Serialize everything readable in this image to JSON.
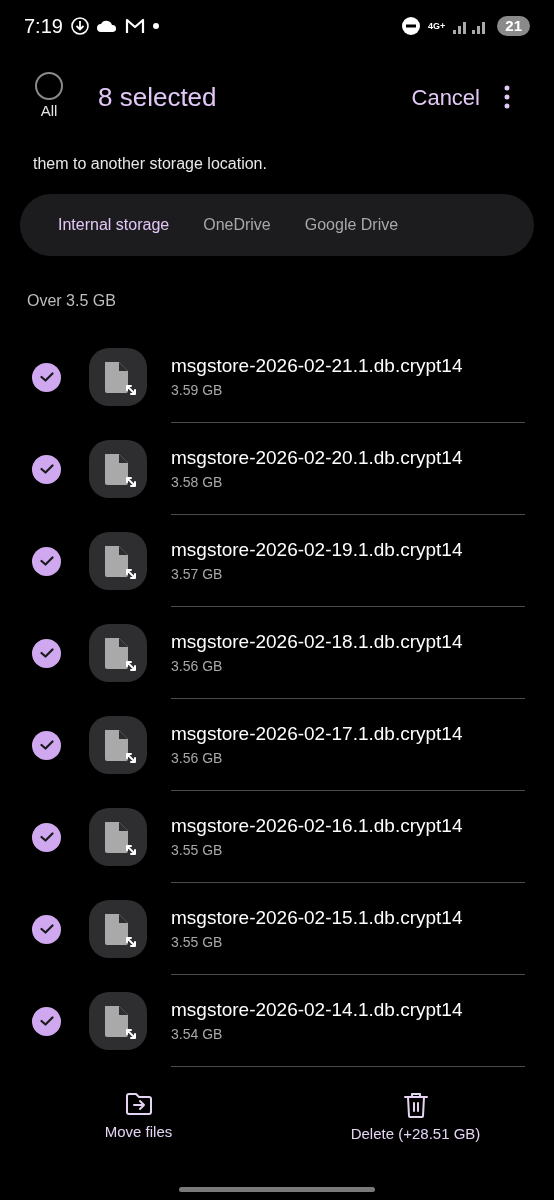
{
  "status_bar": {
    "time": "7:19",
    "network": "4G+",
    "battery": "21"
  },
  "header": {
    "select_all": {
      "label": "All",
      "checked": false
    },
    "title": "8 selected",
    "cancel": "Cancel"
  },
  "description": "them to another storage location.",
  "tabs": [
    {
      "label": "Internal storage",
      "selected": true
    },
    {
      "label": "OneDrive",
      "selected": false
    },
    {
      "label": "Google Drive",
      "selected": false
    }
  ],
  "section_title": "Over 3.5 GB",
  "files": [
    {
      "name": "msgstore-2026-02-21.1.db.crypt14",
      "size": "3.59 GB",
      "checked": true
    },
    {
      "name": "msgstore-2026-02-20.1.db.crypt14",
      "size": "3.58 GB",
      "checked": true
    },
    {
      "name": "msgstore-2026-02-19.1.db.crypt14",
      "size": "3.57 GB",
      "checked": true
    },
    {
      "name": "msgstore-2026-02-18.1.db.crypt14",
      "size": "3.56 GB",
      "checked": true
    },
    {
      "name": "msgstore-2026-02-17.1.db.crypt14",
      "size": "3.56 GB",
      "checked": true
    },
    {
      "name": "msgstore-2026-02-16.1.db.crypt14",
      "size": "3.55 GB",
      "checked": true
    },
    {
      "name": "msgstore-2026-02-15.1.db.crypt14",
      "size": "3.55 GB",
      "checked": true
    },
    {
      "name": "msgstore-2026-02-14.1.db.crypt14",
      "size": "3.54 GB",
      "checked": true
    }
  ],
  "actions": [
    {
      "kind": "move",
      "label": "Move files"
    },
    {
      "kind": "delete",
      "label": "Delete (+28.51 GB)"
    }
  ]
}
